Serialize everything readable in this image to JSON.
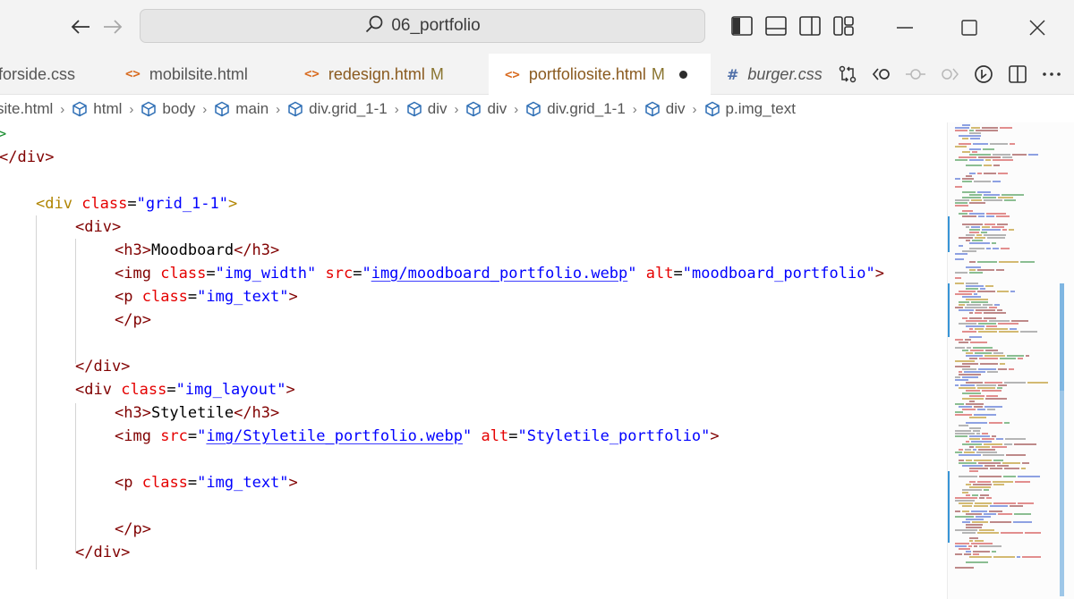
{
  "window": {
    "search_text": "06_portfolio"
  },
  "tabs": [
    {
      "label": "forside.css",
      "icon": "css",
      "status": ""
    },
    {
      "label": "mobilsite.html",
      "icon": "html",
      "status": ""
    },
    {
      "label": "redesign.html",
      "icon": "html",
      "status": "M"
    },
    {
      "label": "portfoliosite.html",
      "icon": "html",
      "status": "M"
    },
    {
      "label": "burger.css",
      "icon": "css",
      "status": ""
    }
  ],
  "breadcrumb": [
    "site.html",
    "html",
    "body",
    "main",
    "div.grid_1-1",
    "div",
    "div",
    "div.grid_1-1",
    "div",
    "p.img_text"
  ],
  "code": {
    "l1": ">",
    "l2_close": "</",
    "l2_name": "div",
    "l2_end": ">",
    "l4_open": "<div",
    "l4_attr": "class",
    "l4_eq": "=",
    "l4_val": "\"grid_1-1\"",
    "l4_end": ">",
    "l5": "<div>",
    "l6_open": "<h3>",
    "l6_text": "Moodboard",
    "l6_close": "</h3>",
    "l7_open": "<img",
    "l7_a1": "class",
    "l7_v1": "\"img_width\"",
    "l7_a2": "src",
    "l7_v2q1": "\"",
    "l7_v2": "img/moodboard_portfolio.webp",
    "l7_v2q2": "\"",
    "l7_a3": "alt",
    "l7_v3": "\"moodboard_portfolio\"",
    "l7_end": ">",
    "l8_open": "<p",
    "l8_attr": "class",
    "l8_val": "\"img_text\"",
    "l8_end": ">",
    "l9": "</p>",
    "l11": "</div>",
    "l12_open": "<div",
    "l12_attr": "class",
    "l12_val": "\"img_layout\"",
    "l12_end": ">",
    "l13_open": "<h3>",
    "l13_text": "Styletile",
    "l13_close": "</h3>",
    "l14_open": "<img",
    "l14_a1": "src",
    "l14_v1q1": "\"",
    "l14_v1": "img/Styletile_portfolio.webp",
    "l14_v1q2": "\"",
    "l14_a2": "alt",
    "l14_v2": "\"Styletile_portfolio\"",
    "l14_end": ">",
    "l16_open": "<p",
    "l16_attr": "class",
    "l16_val": "\"img_text\"",
    "l16_end": ">",
    "l18": "</p>",
    "l19": "</div>"
  },
  "colors": {
    "tag": "#800000",
    "attribute": "#e50000",
    "string": "#0000ff",
    "text": "#000000",
    "minimap_change_bar": "#7fb6e2"
  }
}
